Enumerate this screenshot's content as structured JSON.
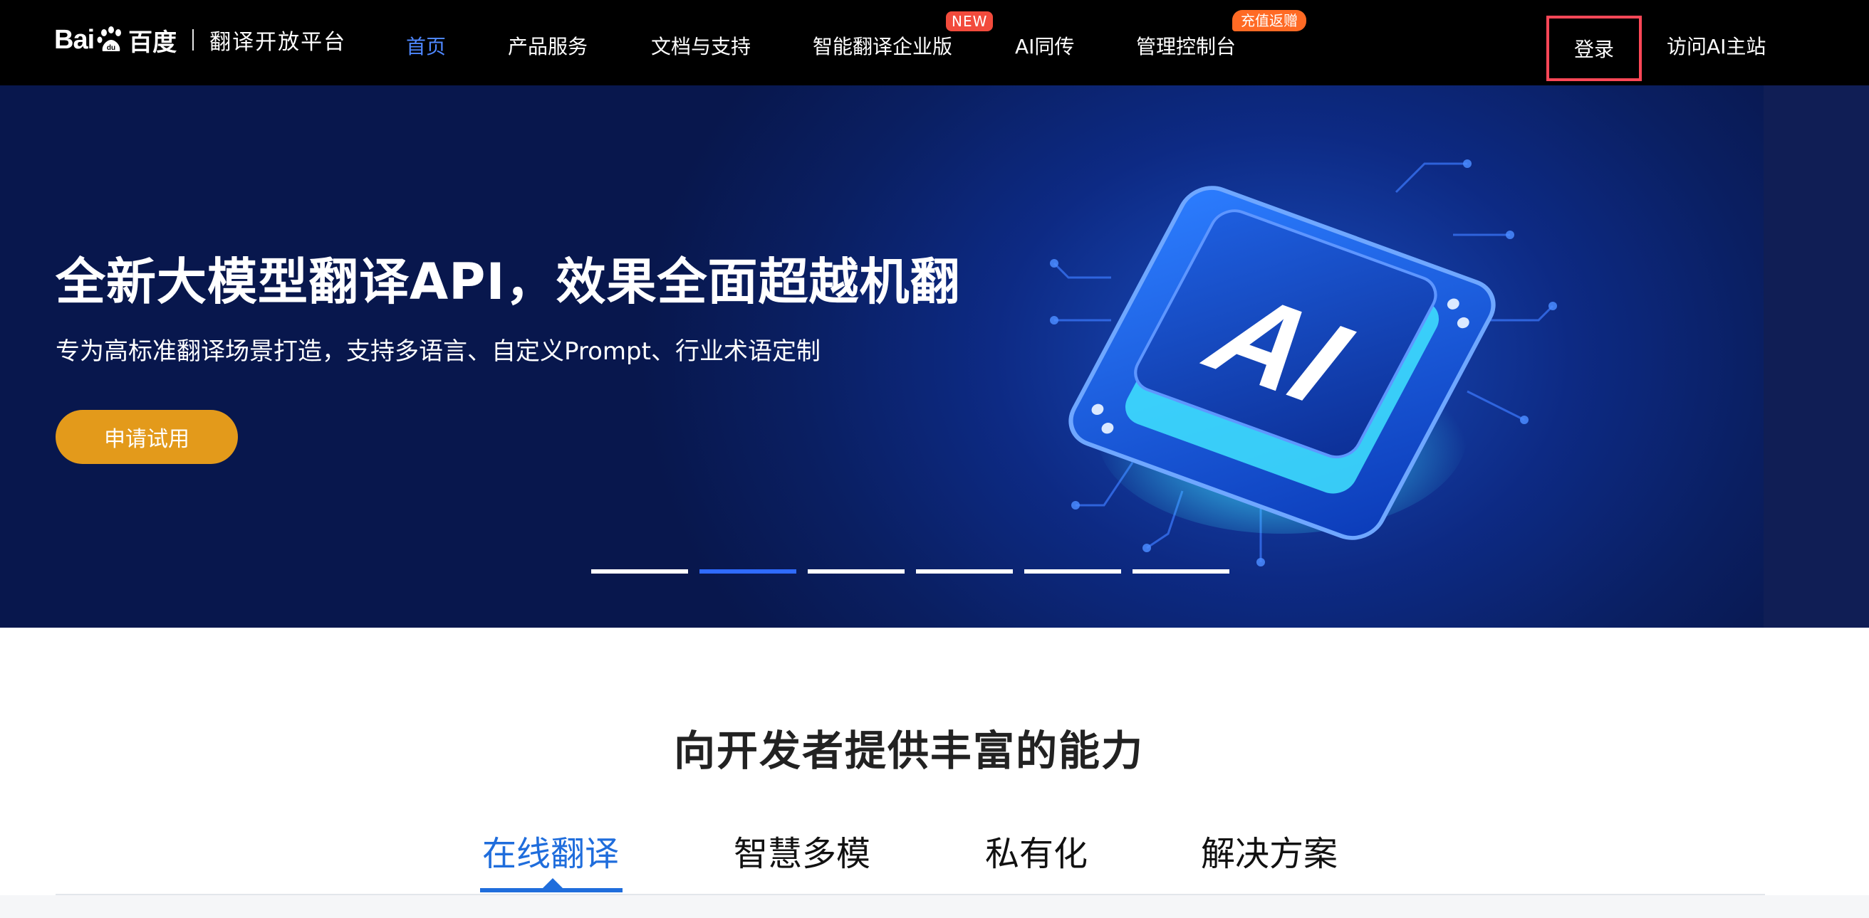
{
  "header": {
    "logo": {
      "bai": "Bai",
      "du": "百度",
      "platform": "翻译开放平台"
    },
    "nav": [
      {
        "label": "首页",
        "active": true
      },
      {
        "label": "产品服务"
      },
      {
        "label": "文档与支持"
      },
      {
        "label": "智能翻译企业版",
        "badge": "NEW"
      },
      {
        "label": "AI同传"
      },
      {
        "label": "管理控制台",
        "badge": "充值返赠"
      }
    ],
    "login_label": "登录",
    "visit_label": "访问AI主站"
  },
  "hero": {
    "title": "全新大模型翻译API，效果全面超越机翻",
    "subtitle": "专为高标准翻译场景打造，支持多语言、自定义Prompt、行业术语定制",
    "cta_label": "申请试用",
    "chip_text": "AI",
    "carousel": {
      "count": 6,
      "active_index": 1
    }
  },
  "section": {
    "title": "向开发者提供丰富的能力",
    "tabs": [
      {
        "label": "在线翻译",
        "active": true
      },
      {
        "label": "智慧多模"
      },
      {
        "label": "私有化"
      },
      {
        "label": "解决方案"
      }
    ]
  },
  "colors": {
    "nav_active": "#4e87ff",
    "cta": "#e39a1b",
    "tab_active": "#1f6ddc",
    "login_highlight": "#ff4757",
    "badge_new": "#f24b3c",
    "badge_promo": "#ff6a24"
  }
}
